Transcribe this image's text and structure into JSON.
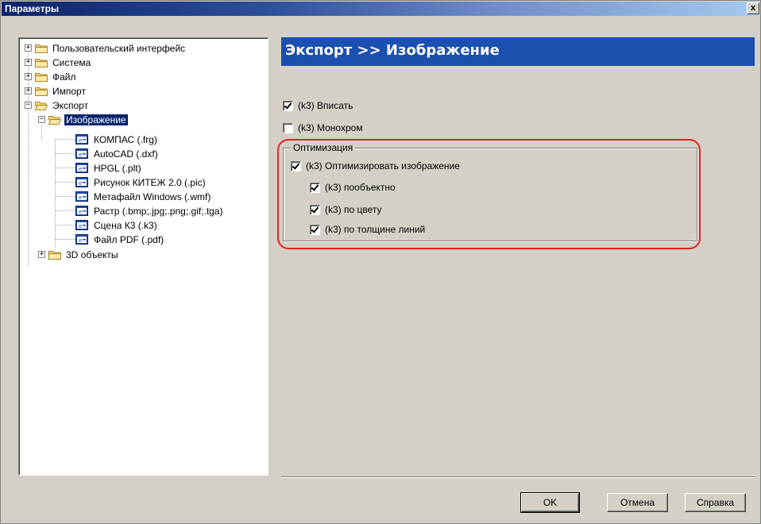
{
  "window": {
    "title": "Параметры",
    "close_label": "x"
  },
  "tree": {
    "items": [
      {
        "label": "Пользовательский интерфейс"
      },
      {
        "label": "Система"
      },
      {
        "label": "Файл"
      },
      {
        "label": "Импорт"
      },
      {
        "label": "Экспорт"
      },
      {
        "label": "Изображение"
      },
      {
        "label": "КОМПАС (.frg)"
      },
      {
        "label": "AutoCAD (.dxf)"
      },
      {
        "label": "HPGL (.plt)"
      },
      {
        "label": "Рисунок КИТЕЖ 2.0 (.pic)"
      },
      {
        "label": "Метафайл Windows (.wmf)"
      },
      {
        "label": "Растр (.bmp;.jpg;.png;.gif;.tga)"
      },
      {
        "label": "Сцена К3 (.k3)"
      },
      {
        "label": "Файл PDF (.pdf)"
      },
      {
        "label": "3D объекты"
      }
    ]
  },
  "panel": {
    "header": "Экспорт >> Изображение",
    "fit": {
      "label": "(k3) Вписать",
      "checked": true
    },
    "mono": {
      "label": "(k3) Монохром",
      "checked": false
    },
    "group": {
      "title": "Оптимизация",
      "optimize": {
        "label": "(k3) Оптимизировать изображение",
        "checked": true
      },
      "per_object": {
        "label": "(k3) пообъектно",
        "checked": true
      },
      "by_color": {
        "label": "(k3) по цвету",
        "checked": true
      },
      "by_width": {
        "label": "(k3) по толщине линий",
        "checked": true
      }
    }
  },
  "buttons": {
    "ok": "OK",
    "cancel": "Отмена",
    "help": "Справка"
  },
  "colors": {
    "header_bg": "#1b4fb0",
    "highlight": "#e8221f",
    "selection": "#0a246a"
  }
}
